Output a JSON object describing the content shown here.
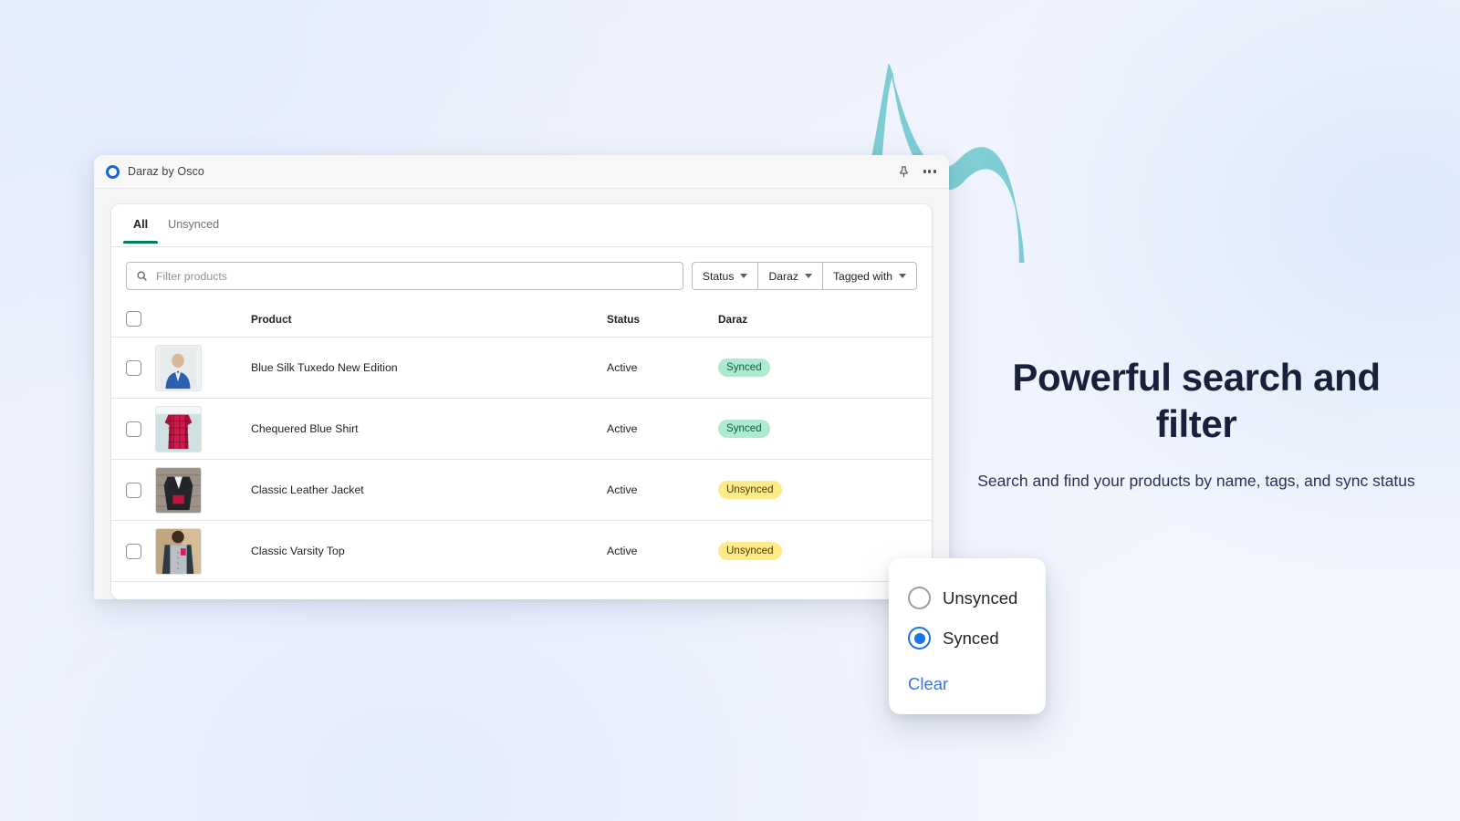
{
  "window": {
    "brand_name": "Daraz by Osco",
    "logo_icon": "ring-logo-icon",
    "pin_icon": "pin-icon",
    "more_icon": "more-options-icon"
  },
  "tabs": [
    {
      "label": "All",
      "active": true
    },
    {
      "label": "Unsynced",
      "active": false
    }
  ],
  "filters": {
    "search_placeholder": "Filter products",
    "search_value": "",
    "search_icon": "search-icon",
    "buttons": [
      {
        "label": "Status"
      },
      {
        "label": "Daraz"
      },
      {
        "label": "Tagged with"
      }
    ]
  },
  "table": {
    "columns": [
      "",
      "",
      "Product",
      "Status",
      "Daraz"
    ],
    "rows": [
      {
        "product": "Blue Silk Tuxedo New Edition",
        "status": "Active",
        "sync": "Synced",
        "sync_kind": "synced",
        "thumb": "man-in-blue-tuxedo-photo"
      },
      {
        "product": "Chequered Blue Shirt",
        "status": "Active",
        "sync": "Synced",
        "sync_kind": "synced",
        "thumb": "red-check-shirt-photo"
      },
      {
        "product": "Classic Leather Jacket",
        "status": "Active",
        "sync": "Unsynced",
        "sync_kind": "unsynced",
        "thumb": "black-leather-jacket-photo"
      },
      {
        "product": "Classic Varsity Top",
        "status": "Active",
        "sync": "Unsynced",
        "sync_kind": "unsynced",
        "thumb": "grey-varsity-top-photo"
      }
    ]
  },
  "promo": {
    "title": "Powerful search and filter",
    "subtitle": "Search and find your products by name, tags, and sync status"
  },
  "popover": {
    "options": [
      {
        "label": "Unsynced",
        "selected": false
      },
      {
        "label": "Synced",
        "selected": true
      }
    ],
    "clear_label": "Clear"
  },
  "colors": {
    "tab_active_underline": "#008060",
    "badge_synced_bg": "#aee9d1",
    "badge_unsynced_bg": "#ffea8a",
    "radio_selected": "#1a73e8",
    "clear_link": "#3f74d9",
    "brand_logo": "#1665d8",
    "wave_decoration": "#62c6cc"
  }
}
